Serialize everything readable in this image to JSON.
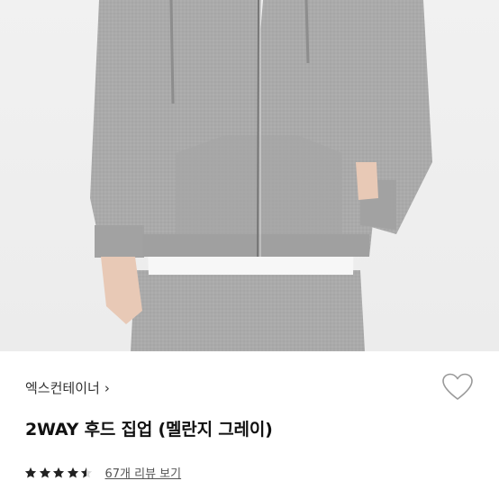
{
  "product": {
    "brand": "엑스컨테이너",
    "brand_chevron": "›",
    "title": "2WAY 후드 집업 (멜란지 그레이)",
    "rating": 4.5,
    "review_link": "67개 리뷰 보기"
  },
  "icons": {
    "heart": "heart-outline-icon",
    "star": "star-icon",
    "chevron": "chevron-right-icon"
  },
  "colors": {
    "star_fill": "#222222",
    "heart_stroke": "#999999",
    "hoodie": "#a9a9a9"
  }
}
